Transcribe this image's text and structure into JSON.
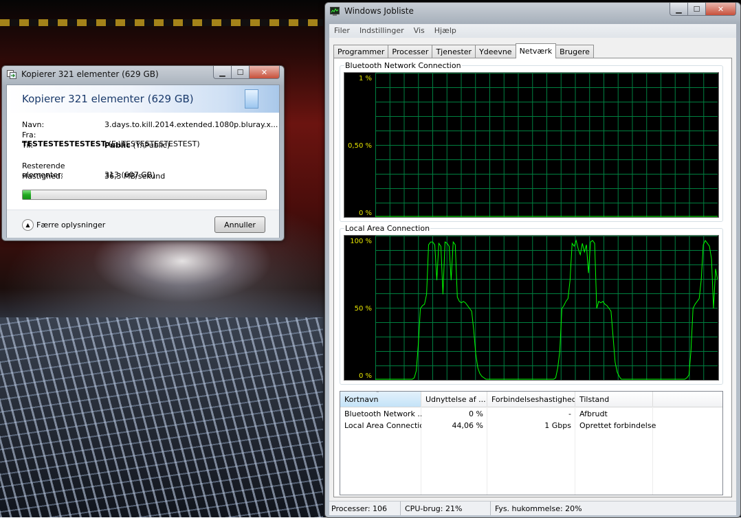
{
  "copy_dialog": {
    "title": "Kopierer 321 elementer (629 GB)",
    "heading": "Kopierer 321 elementer (629 GB)",
    "name_label": "Navn:",
    "name_value": "3.days.to.kill.2014.extended.1080p.bluray.x...",
    "from_label": "Fra:",
    "from_bold": "TESTESTESTESTEST",
    "from_path": "(E:\\TESTESTESTESTEST)",
    "to_label": "Til:",
    "to_bold": "Public",
    "to_path": "(Y:\\Public)",
    "remaining_label": "Resterende elementer:",
    "remaining_value": "313 (607 GB)",
    "speed_label": "Hastighed:",
    "speed_value": "36,3 MB/sekund",
    "progress_fraction": 0.035,
    "fewer_details_label": "Færre oplysninger",
    "cancel_label": "Annuller"
  },
  "task_manager": {
    "title": "Windows Jobliste",
    "menu": [
      "Filer",
      "Indstillinger",
      "Vis",
      "Hjælp"
    ],
    "tabs": [
      "Programmer",
      "Processer",
      "Tjenester",
      "Ydeevne",
      "Netværk",
      "Brugere"
    ],
    "active_tab": "Netværk",
    "graphs": [
      {
        "label": "Bluetooth Network Connection",
        "y_labels": [
          "1 %",
          "0,50 %",
          "0 %"
        ]
      },
      {
        "label": "Local Area Connection",
        "y_labels": [
          "100 %",
          "50 %",
          "0 %"
        ]
      }
    ],
    "columns": [
      "Kortnavn",
      "Udnyttelse af ...",
      "Forbindelseshastighed",
      "Tilstand"
    ],
    "rows": [
      {
        "name": "Bluetooth Network ...",
        "utilization": "0 %",
        "speed": "-",
        "state": "Afbrudt"
      },
      {
        "name": "Local Area Connection",
        "utilization": "44,06 %",
        "speed": "1 Gbps",
        "state": "Oprettet forbindelse"
      }
    ],
    "status": {
      "processes": "Processer: 106",
      "cpu": "CPU-brug: 21%",
      "memory": "Fys. hukommelse: 20%"
    },
    "graph_color": "#00ff00",
    "grid_color": "#008040"
  },
  "chart_data": [
    {
      "type": "line",
      "title": "Bluetooth Network Connection",
      "ylim": [
        0,
        1
      ],
      "y_tick_labels": [
        "1 %",
        "0,50 %",
        "0 %"
      ],
      "series": [
        {
          "values": [
            0
          ]
        }
      ]
    },
    {
      "type": "line",
      "title": "Local Area Connection",
      "ylim": [
        0,
        100
      ],
      "y_tick_labels": [
        "100 %",
        "50 %",
        "0 %"
      ],
      "series": [
        {
          "values": [
            0,
            0,
            0,
            0,
            0,
            0,
            0,
            0,
            0,
            0,
            0,
            0,
            0,
            0,
            0,
            0,
            0,
            0,
            0,
            1,
            6,
            25,
            50,
            52,
            53,
            60,
            95,
            97,
            97,
            95,
            70,
            96,
            94,
            60,
            97,
            96,
            94,
            70,
            97,
            95,
            58,
            55,
            54,
            55,
            54,
            52,
            50,
            48,
            35,
            18,
            8,
            4,
            2,
            1,
            0,
            0,
            0,
            0,
            0,
            0,
            0,
            0,
            0,
            0,
            0,
            0,
            0,
            0,
            0,
            0,
            0,
            0,
            0,
            0,
            0,
            0,
            0,
            0,
            0,
            0,
            0,
            0,
            0,
            0,
            0,
            0,
            0,
            0,
            1,
            8,
            20,
            50,
            52,
            55,
            57,
            70,
            96,
            94,
            98,
            92,
            88,
            96,
            90,
            95,
            75,
            97,
            98,
            96,
            50,
            55,
            54,
            55,
            53,
            52,
            50,
            48,
            30,
            12,
            5,
            2,
            0,
            0,
            0,
            0,
            0,
            0,
            0,
            0,
            0,
            0,
            0,
            0,
            0,
            0,
            0,
            0,
            0,
            0,
            0,
            0,
            0,
            0,
            0,
            0,
            0,
            0,
            0,
            0,
            0,
            0,
            0,
            0,
            1,
            3,
            20,
            50,
            53,
            55,
            57,
            70,
            95,
            98,
            96,
            94,
            85,
            50,
            78,
            70
          ]
        }
      ]
    }
  ]
}
